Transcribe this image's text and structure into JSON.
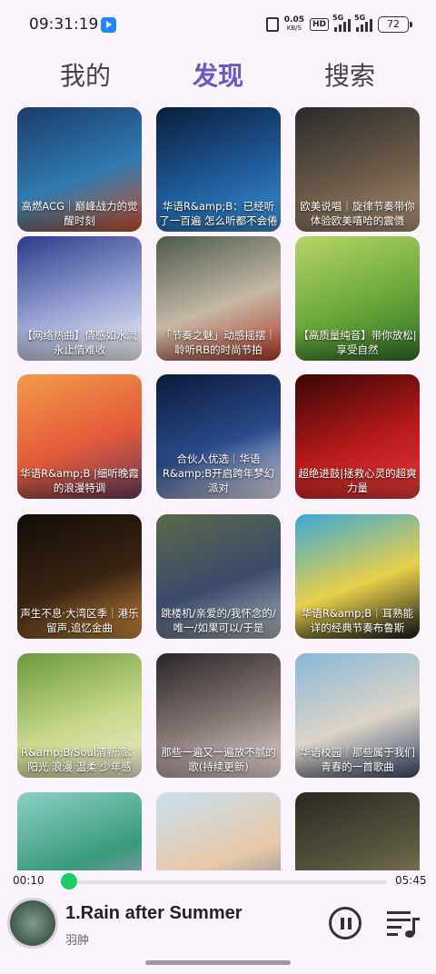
{
  "status_bar": {
    "time": "09:31:19",
    "net_speed_value": "0.05",
    "net_speed_unit": "KB/S",
    "hd_label": "HD",
    "signal1_label": "5G",
    "signal2_label": "5G",
    "battery": "72"
  },
  "tabs": [
    {
      "label": "我的",
      "active": false
    },
    {
      "label": "发现",
      "active": true
    },
    {
      "label": "搜索",
      "active": false
    }
  ],
  "playlists": [
    {
      "caption": "高燃ACG｜巅峰战力的觉醒时刻",
      "colors": [
        "#1b3b6b",
        "#2f7ab0",
        "#c8502a"
      ]
    },
    {
      "caption": "华语R&amp;B：已经听了一百遍 怎么听都不会倦",
      "colors": [
        "#0b1e3a",
        "#1f5a9a",
        "#3b8fd0"
      ]
    },
    {
      "caption": "欧美说唱｜旋律节奏带你体验欧美嘻哈的震慑",
      "colors": [
        "#2a2a2a",
        "#6b5a48",
        "#a88c70"
      ]
    },
    {
      "caption": "【网络热曲】情感如水流 永止情难收",
      "colors": [
        "#2c3a8a",
        "#9aa6d6",
        "#f2f2f2"
      ]
    },
    {
      "caption": "「节奏之魅」动感摇摆｜聆听RB的时尚节拍",
      "colors": [
        "#4a5a4a",
        "#c6b8a6",
        "#b23a2a"
      ]
    },
    {
      "caption": "【高质量纯音】带你放松|享受自然",
      "colors": [
        "#b8d468",
        "#6aa83a",
        "#2f6d2a"
      ]
    },
    {
      "caption": "华语R&amp;B |细听晚霞的浪漫特调",
      "colors": [
        "#f29b4a",
        "#e45a3a",
        "#6a3a5a"
      ]
    },
    {
      "caption": "合伙人优选｜华语R&amp;B开启跨年梦幻派对",
      "colors": [
        "#0c1a3a",
        "#2a4a8a",
        "#e8e4f0"
      ]
    },
    {
      "caption": "超绝进鼓|拯救心灵的超爽力量",
      "colors": [
        "#3a0606",
        "#b81a1a",
        "#e03a3a"
      ]
    },
    {
      "caption": "声生不息·大湾区季｜港乐留声,追忆金曲",
      "colors": [
        "#120c08",
        "#3a2412",
        "#c8843a"
      ]
    },
    {
      "caption": "跳楼机/亲爱的/我怀念的/唯一/如果可以/于是",
      "colors": [
        "#5a6a4a",
        "#3a4a6a",
        "#a8b0b8"
      ]
    },
    {
      "caption": "华语R&amp;B｜耳熟能详的经典节奏布鲁斯",
      "colors": [
        "#3aa8d8",
        "#e8d04a",
        "#1a1a1a"
      ]
    },
    {
      "caption": "R&amp;B/Soul清新派：阳光 浪漫 温柔 少年感",
      "colors": [
        "#6a9a3a",
        "#c8d88a",
        "#f0e8d0"
      ]
    },
    {
      "caption": "那些一遍又一遍放不腻的歌(持续更新)",
      "colors": [
        "#2a2426",
        "#8a7a78",
        "#e8d8d4"
      ]
    },
    {
      "caption": "华语校园｜那些属于我们青春的一首歌曲",
      "colors": [
        "#88b8d8",
        "#dcd4c8",
        "#3a4a6a"
      ]
    },
    {
      "caption": "",
      "colors": [
        "#8ad0c8",
        "#3a9a7a",
        "#c890d8"
      ]
    },
    {
      "caption": "",
      "colors": [
        "#c8e0f0",
        "#e8c8a8",
        "#5a7a98"
      ]
    },
    {
      "caption": "",
      "colors": [
        "#2a2820",
        "#5a5840",
        "#9a9068"
      ]
    }
  ],
  "player": {
    "elapsed": "00:10",
    "duration": "05:45",
    "progress_fraction": 0.029,
    "title": "1.Rain after Summer",
    "artist": "羽肿",
    "accent": "#18cf62"
  },
  "icons": {
    "pause": "pause-circle-icon",
    "playlist": "playlist-music-icon"
  }
}
